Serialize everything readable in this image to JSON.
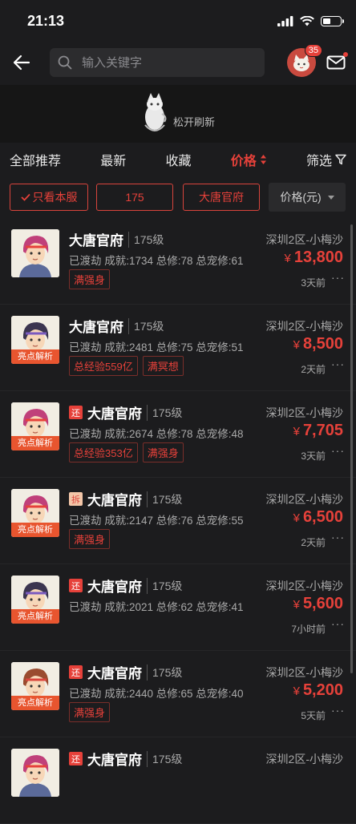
{
  "status": {
    "time": "21:13"
  },
  "nav": {
    "search_placeholder": "输入关键字",
    "notification_count": "35"
  },
  "refresh": {
    "text": "松开刷新"
  },
  "sort_tabs": [
    {
      "label": "全部推荐",
      "active": false
    },
    {
      "label": "最新",
      "active": false
    },
    {
      "label": "收藏",
      "active": false
    },
    {
      "label": "价格",
      "active": true
    },
    {
      "label": "筛选",
      "active": false
    }
  ],
  "filters": {
    "only_server": "只看本服",
    "level": "175",
    "school": "大唐官府",
    "price_unit": "价格(元)"
  },
  "colors": {
    "accent": "#e6413a",
    "background": "#1c1c1e",
    "highlight_tag": "#e8552f"
  },
  "items": [
    {
      "name": "大唐官府",
      "level": "175级",
      "server": "深圳2区-小梅沙",
      "stats": "已渡劫 成就:1734 总修:78 总宠修:61",
      "price": "13,800",
      "time": "3天前",
      "tags": [
        "满强身"
      ],
      "badge": "",
      "highlight": ""
    },
    {
      "name": "大唐官府",
      "level": "175级",
      "server": "深圳2区-小梅沙",
      "stats": "已渡劫 成就:2481 总修:75 总宠修:51",
      "price": "8,500",
      "time": "2天前",
      "tags": [
        "总经验559亿",
        "满冥想"
      ],
      "badge": "",
      "highlight": "亮点解析"
    },
    {
      "name": "大唐官府",
      "level": "175级",
      "server": "深圳2区-小梅沙",
      "stats": "已渡劫 成就:2674 总修:78 总宠修:48",
      "price": "7,705",
      "time": "3天前",
      "tags": [
        "总经验353亿",
        "满强身"
      ],
      "badge": "还",
      "highlight": "亮点解析"
    },
    {
      "name": "大唐官府",
      "level": "175级",
      "server": "深圳2区-小梅沙",
      "stats": "已渡劫 成就:2147 总修:76 总宠修:55",
      "price": "6,500",
      "time": "2天前",
      "tags": [
        "满强身"
      ],
      "badge": "拆",
      "highlight": "亮点解析"
    },
    {
      "name": "大唐官府",
      "level": "175级",
      "server": "深圳2区-小梅沙",
      "stats": "已渡劫 成就:2021 总修:62 总宠修:41",
      "price": "5,600",
      "time": "7小时前",
      "tags": [],
      "badge": "还",
      "highlight": "亮点解析"
    },
    {
      "name": "大唐官府",
      "level": "175级",
      "server": "深圳2区-小梅沙",
      "stats": "已渡劫 成就:2440 总修:65 总宠修:40",
      "price": "5,200",
      "time": "5天前",
      "tags": [
        "满强身"
      ],
      "badge": "还",
      "highlight": "亮点解析"
    },
    {
      "name": "大唐官府",
      "level": "175级",
      "server": "深圳2区-小梅沙",
      "stats": "",
      "price": "",
      "time": "",
      "tags": [],
      "badge": "还",
      "highlight": ""
    }
  ]
}
